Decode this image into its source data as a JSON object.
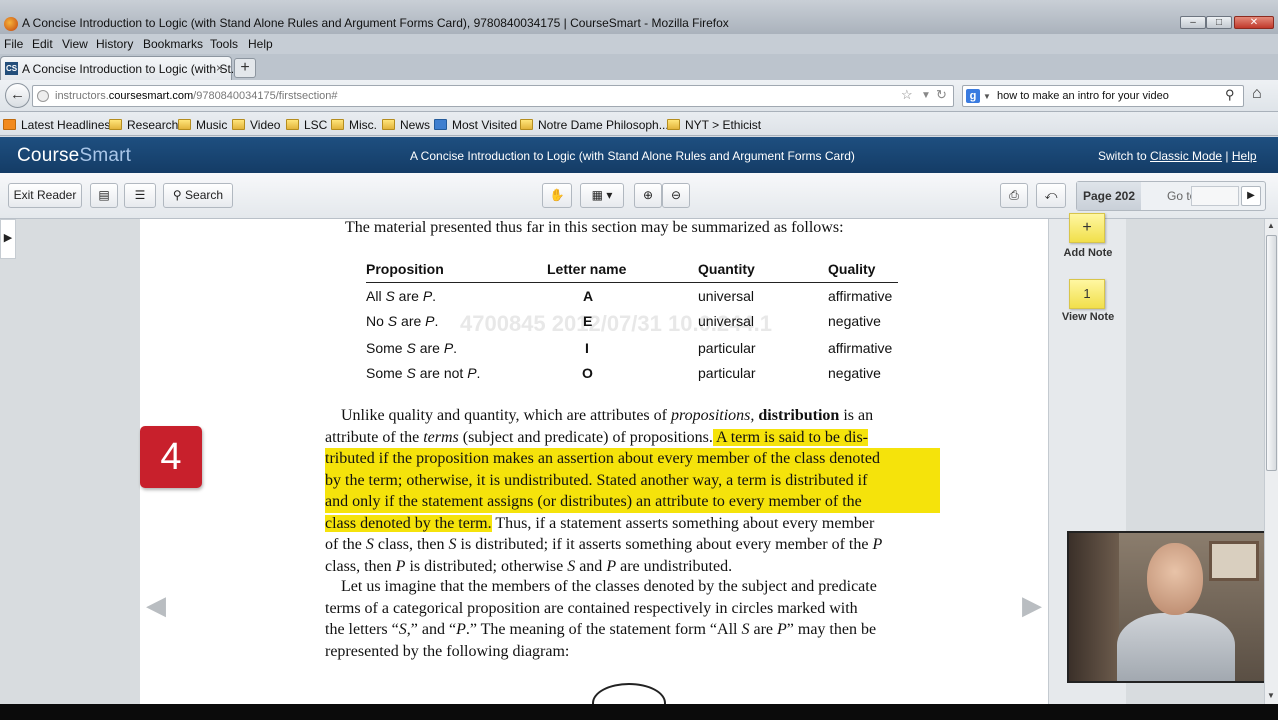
{
  "window": {
    "title": "A Concise Introduction to Logic (with Stand Alone Rules and Argument Forms Card), 9780840034175 | CourseSmart - Mozilla Firefox",
    "controls": [
      "–",
      "□",
      "✕"
    ]
  },
  "menu": [
    "File",
    "Edit",
    "View",
    "History",
    "Bookmarks",
    "Tools",
    "Help"
  ],
  "tabs": [
    {
      "label": "A Concise Introduction to Logic (with St...",
      "favicon": "CS",
      "close": "×"
    }
  ],
  "new_tab_label": "+",
  "nav": {
    "url_domain": "instructors.",
    "url_host": "coursesmart.com",
    "url_path": "/9780840034175/firstsection#",
    "search_value": "how to make an intro for your video",
    "search_engine_letter": "g"
  },
  "bookmarks": [
    {
      "label": "Latest Headlines",
      "icon": "rss"
    },
    {
      "label": "Research",
      "icon": "folder"
    },
    {
      "label": "Music",
      "icon": "folder"
    },
    {
      "label": "Video",
      "icon": "folder"
    },
    {
      "label": "LSC",
      "icon": "folder"
    },
    {
      "label": "Misc.",
      "icon": "folder"
    },
    {
      "label": "News",
      "icon": "folder"
    },
    {
      "label": "Most Visited",
      "icon": "most-visited"
    },
    {
      "label": "Notre Dame Philosoph...",
      "icon": "folder"
    },
    {
      "label": "NYT > Ethicist",
      "icon": "folder"
    }
  ],
  "coursesmart": {
    "logo_a": "Course",
    "logo_b": "Smart",
    "book_title": "A Concise Introduction to Logic (with Stand Alone Rules and Argument Forms Card)",
    "switch_prefix": "Switch to ",
    "switch_link": "Classic Mode",
    "separator": " | ",
    "help_link": "Help"
  },
  "toolbar": {
    "exit_reader": "Exit Reader",
    "search": "Search",
    "page_label": "Page 202",
    "goto_label": "Go to",
    "goto_value": ""
  },
  "page": {
    "chapter_number": "4",
    "watermark": "4700845 2012/07/31 10.0.244.1",
    "intro_line": "The material presented thus far in this section may be summarized as follows:",
    "table": {
      "headers": [
        "Proposition",
        "Letter name",
        "Quantity",
        "Quality"
      ],
      "rows": [
        {
          "prop_a": "All ",
          "s": "S",
          "prop_b": " are ",
          "p": "P",
          "end": ".",
          "letter": "A",
          "quantity": "universal",
          "quality": "affirmative"
        },
        {
          "prop_a": "No ",
          "s": "S",
          "prop_b": " are ",
          "p": "P",
          "end": ".",
          "letter": "E",
          "quantity": "universal",
          "quality": "negative"
        },
        {
          "prop_a": "Some ",
          "s": "S",
          "prop_b": " are ",
          "p": "P",
          "end": ".",
          "letter": "I",
          "quantity": "particular",
          "quality": "affirmative"
        },
        {
          "prop_a": "Some ",
          "s": "S",
          "prop_b": " are not ",
          "p": "P",
          "end": ".",
          "letter": "O",
          "quantity": "particular",
          "quality": "negative"
        }
      ]
    },
    "para1": {
      "l1a": "Unlike quality and quantity, which are attributes of ",
      "l1b": "propositions,",
      "l1c": " ",
      "l1d": "distribution",
      "l1e": " is an",
      "l2a": "attribute of the ",
      "l2b": "terms",
      "l2c": " (subject and predicate) of propositions.",
      "l2d": " A term is said to be dis-",
      "l3": "tributed if the proposition makes an assertion about every member of the class denoted",
      "l4": "by the term; otherwise, it is undistributed. Stated another way, a term is distributed if",
      "l5": "and only if the statement assigns (or distributes) an attribute to every member of the",
      "l6a": "class denoted by the term.",
      "l6b": " Thus, if a statement asserts something about every member",
      "l7a": "of the ",
      "l7b": "S",
      "l7c": " class, then ",
      "l7d": "S",
      "l7e": " is distributed; if it asserts something about every member of the ",
      "l7f": "P",
      "l8a": "class, then ",
      "l8b": "P",
      "l8c": " is distributed; otherwise ",
      "l8d": "S",
      "l8e": " and ",
      "l8f": "P",
      "l8g": " are undistributed."
    },
    "para2": {
      "l1": "Let us imagine that the members of the classes denoted by the subject and predicate",
      "l2": "terms of a categorical proposition are contained respectively in circles marked with",
      "l3a": "the letters “",
      "l3b": "S",
      "l3c": ",” and “",
      "l3d": "P",
      "l3e": ".” The meaning of the statement form “All ",
      "l3f": "S",
      "l3g": " are ",
      "l3h": "P",
      "l3i": "” may then be",
      "l4": "represented by the following diagram:"
    }
  },
  "notes": {
    "add_note": "Add Note",
    "add_symbol": "+",
    "view_note": "View Note",
    "note_count": "1"
  },
  "colors": {
    "header_blue": "#143c66",
    "highlight_yellow": "#f5e30b",
    "chapter_red": "#c8202c",
    "sticky_yellow": "#f1df4b"
  }
}
